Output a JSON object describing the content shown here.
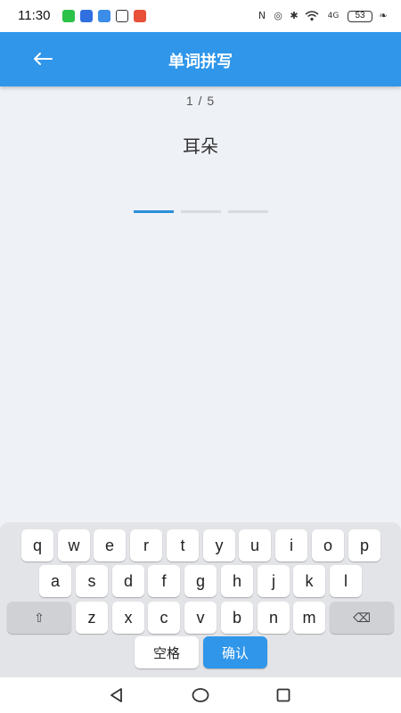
{
  "status_bar": {
    "time": "11:30",
    "battery": "53",
    "network": "4G"
  },
  "header": {
    "title": "单词拼写",
    "back_icon": "arrow-left-icon"
  },
  "quiz": {
    "progress": "1 / 5",
    "word": "耳朵",
    "letter_slots": 3,
    "filled_slots": 0
  },
  "keyboard": {
    "row1": [
      "q",
      "w",
      "e",
      "r",
      "t",
      "y",
      "u",
      "i",
      "o",
      "p"
    ],
    "row2": [
      "a",
      "s",
      "d",
      "f",
      "g",
      "h",
      "j",
      "k",
      "l"
    ],
    "shift": "⇧",
    "row3": [
      "z",
      "x",
      "c",
      "v",
      "b",
      "n",
      "m"
    ],
    "backspace": "⌫",
    "space_label": "空格",
    "confirm_label": "确认"
  },
  "colors": {
    "accent": "#2f96ea",
    "background": "#eef1f6"
  }
}
